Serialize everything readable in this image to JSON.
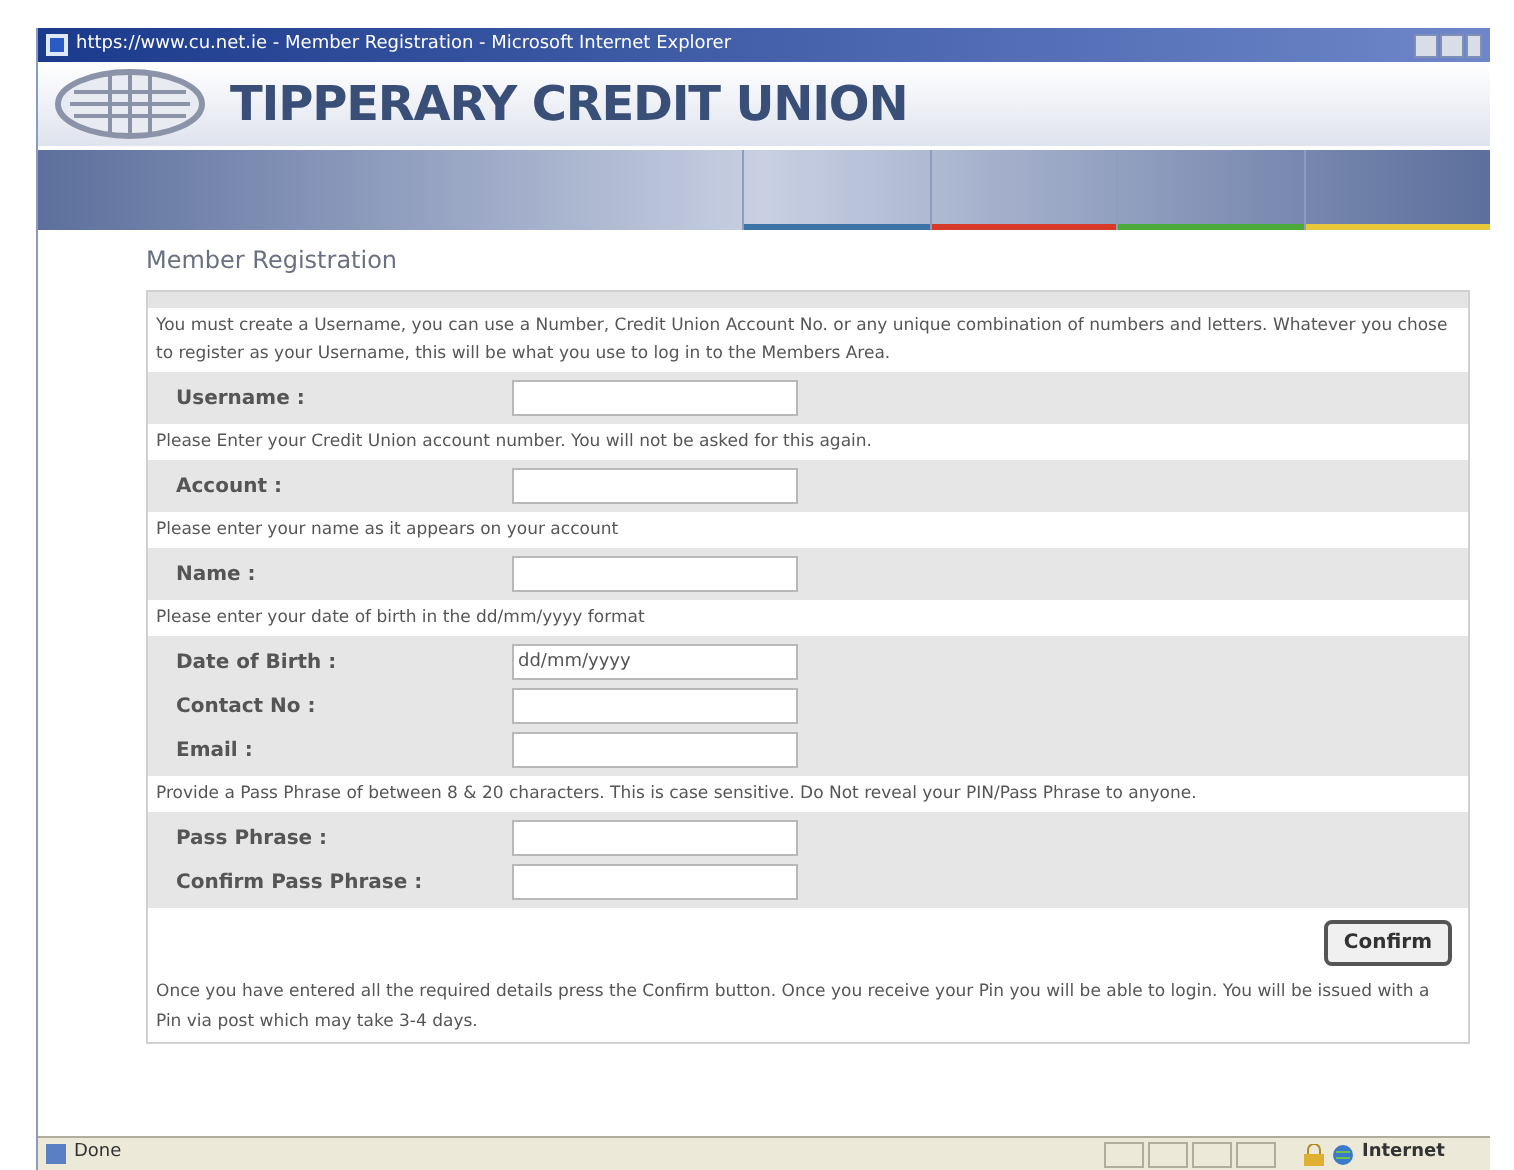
{
  "window": {
    "title": "https://www.cu.net.ie - Member Registration - Microsoft Internet Explorer"
  },
  "header": {
    "brand": "TIPPERARY CREDIT UNION"
  },
  "page": {
    "heading": "Member Registration"
  },
  "form": {
    "rows": [
      {
        "kind": "note",
        "text": "You must create a Username, you can use a Number, Credit Union Account No. or any unique combination of numbers and letters. Whatever you chose to register as your Username, this will be what you use to log in to the Members Area."
      },
      {
        "kind": "field",
        "label": "Username :"
      },
      {
        "kind": "note",
        "text": "Please Enter your Credit Union account number. You will not be asked for this again."
      },
      {
        "kind": "field",
        "label": "Account :"
      },
      {
        "kind": "note",
        "text": "Please enter your name as it appears on your account"
      },
      {
        "kind": "field",
        "label": "Name :"
      },
      {
        "kind": "note",
        "text": "Please enter your date of birth in the dd/mm/yyyy format"
      },
      {
        "kind": "field",
        "label": "Date of Birth :",
        "value": "dd/mm/yyyy"
      },
      {
        "kind": "field",
        "label": "Contact No :"
      },
      {
        "kind": "field",
        "label": "Email :"
      },
      {
        "kind": "note",
        "text": "Provide a Pass Phrase of between 8 & 20 characters. This is case sensitive. Do Not reveal your PIN/Pass Phrase to anyone."
      },
      {
        "kind": "field",
        "label": "Pass Phrase :"
      },
      {
        "kind": "field",
        "label": "Confirm Pass Phrase :"
      }
    ],
    "submit": "Confirm",
    "footer_note": "Once you have entered all the required details press the Confirm button. Once you receive your Pin you will be able to login. You will be issued with a Pin via post which may take 3-4 days."
  },
  "status_bar": {
    "status": "Done",
    "zone": "Internet"
  }
}
